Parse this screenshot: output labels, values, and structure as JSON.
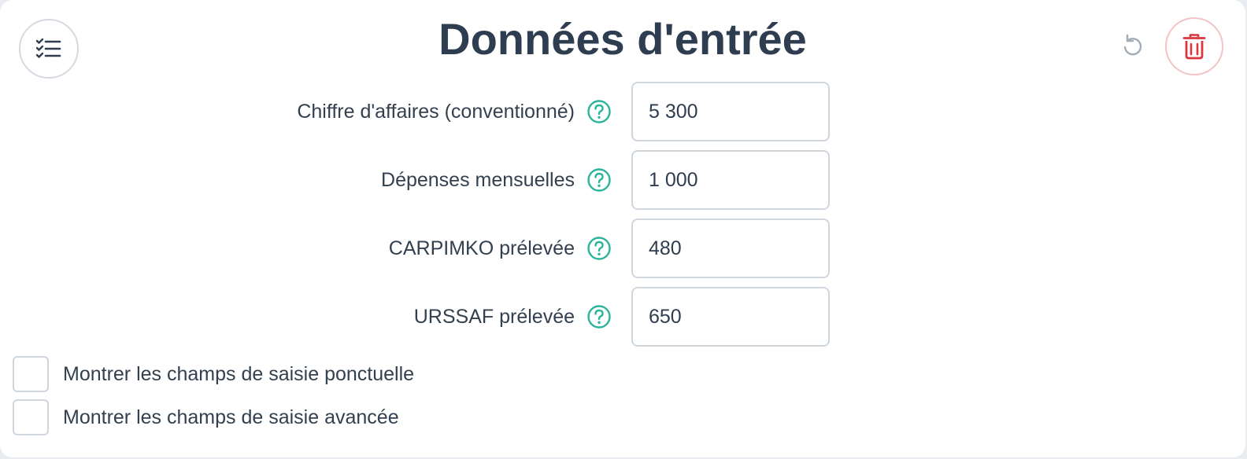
{
  "header": {
    "title": "Données d'entrée",
    "list_icon": "checklist-icon",
    "reset_icon": "undo-icon",
    "delete_icon": "trash-icon"
  },
  "fields": [
    {
      "label": "Chiffre d'affaires (conventionné)",
      "value": "5 300"
    },
    {
      "label": "Dépenses mensuelles",
      "value": "1 000"
    },
    {
      "label": "CARPIMKO prélevée",
      "value": "480"
    },
    {
      "label": "URSSAF prélevée",
      "value": "650"
    }
  ],
  "options": [
    {
      "label": "Montrer les champs de saisie ponctuelle",
      "checked": false
    },
    {
      "label": "Montrer les champs de saisie avancée",
      "checked": false
    }
  ],
  "colors": {
    "title": "#2f3d50",
    "help": "#2bb39b",
    "delete": "#d9363e",
    "border": "#cfd6de"
  }
}
